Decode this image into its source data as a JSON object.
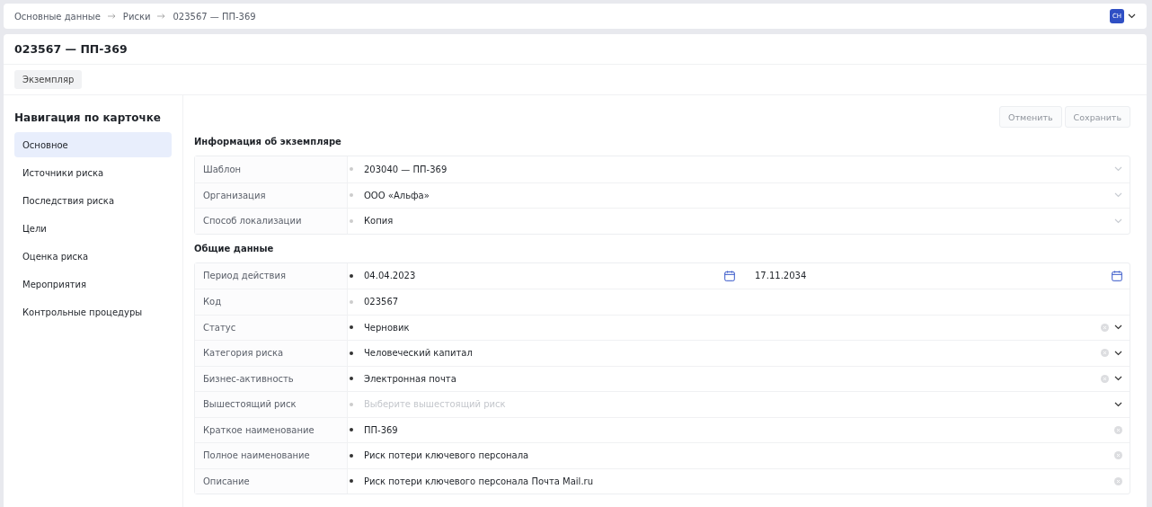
{
  "breadcrumbs": [
    "Основные данные",
    "Риски",
    "023567 — ПП-369"
  ],
  "user": {
    "initials": "СН"
  },
  "title": "023567 — ПП-369",
  "tabs": [
    {
      "label": "Экземпляр",
      "selected": true
    }
  ],
  "nav": {
    "title": "Навигация по карточке",
    "items": [
      {
        "label": "Основное",
        "selected": true
      },
      {
        "label": "Источники риска",
        "selected": false
      },
      {
        "label": "Последствия риска",
        "selected": false
      },
      {
        "label": "Цели",
        "selected": false
      },
      {
        "label": "Оценка риска",
        "selected": false
      },
      {
        "label": "Мероприятия",
        "selected": false
      },
      {
        "label": "Контрольные процедуры",
        "selected": false
      }
    ]
  },
  "actions": [
    {
      "label": "Отменить",
      "disabled": true
    },
    {
      "label": "Сохранить",
      "disabled": true
    }
  ],
  "sections": [
    {
      "title": "Информация об экземпляре",
      "fields": [
        {
          "kind": "select",
          "label": "Шаблон",
          "value": "203040 — ПП-369",
          "required": false,
          "disabled": true,
          "clearable": false
        },
        {
          "kind": "select",
          "label": "Организация",
          "value": "ООО «Альфа»",
          "required": false,
          "disabled": true,
          "clearable": false
        },
        {
          "kind": "select",
          "label": "Способ локализации",
          "value": "Копия",
          "required": false,
          "disabled": true,
          "clearable": false
        }
      ]
    },
    {
      "title": "Общие данные",
      "fields": [
        {
          "kind": "date-range",
          "label": "Период действия",
          "from": "04.04.2023",
          "to": "17.11.2034",
          "required": true
        },
        {
          "kind": "text",
          "label": "Код",
          "value": "023567",
          "required": false,
          "clearable": false
        },
        {
          "kind": "select",
          "label": "Статус",
          "value": "Черновик",
          "required": true,
          "disabled": false,
          "clearable": true
        },
        {
          "kind": "select",
          "label": "Категория риска",
          "value": "Человеческий капитал",
          "required": true,
          "disabled": false,
          "clearable": true
        },
        {
          "kind": "select",
          "label": "Бизнес-активность",
          "value": "Электронная почта",
          "required": true,
          "disabled": false,
          "clearable": true
        },
        {
          "kind": "select",
          "label": "Вышестоящий риск",
          "placeholder": "Выберите вышестоящий риск",
          "required": false,
          "disabled": false,
          "clearable": false
        },
        {
          "kind": "text",
          "label": "Краткое наименование",
          "value": "ПП-369",
          "required": true,
          "clearable": true
        },
        {
          "kind": "text",
          "label": "Полное наименование",
          "value": "Риск потери ключевого персонала",
          "required": true,
          "clearable": true
        },
        {
          "kind": "text",
          "label": "Описание",
          "value": "Риск потери ключевого персонала Почта Mail.ru",
          "required": true,
          "clearable": true
        }
      ]
    }
  ]
}
